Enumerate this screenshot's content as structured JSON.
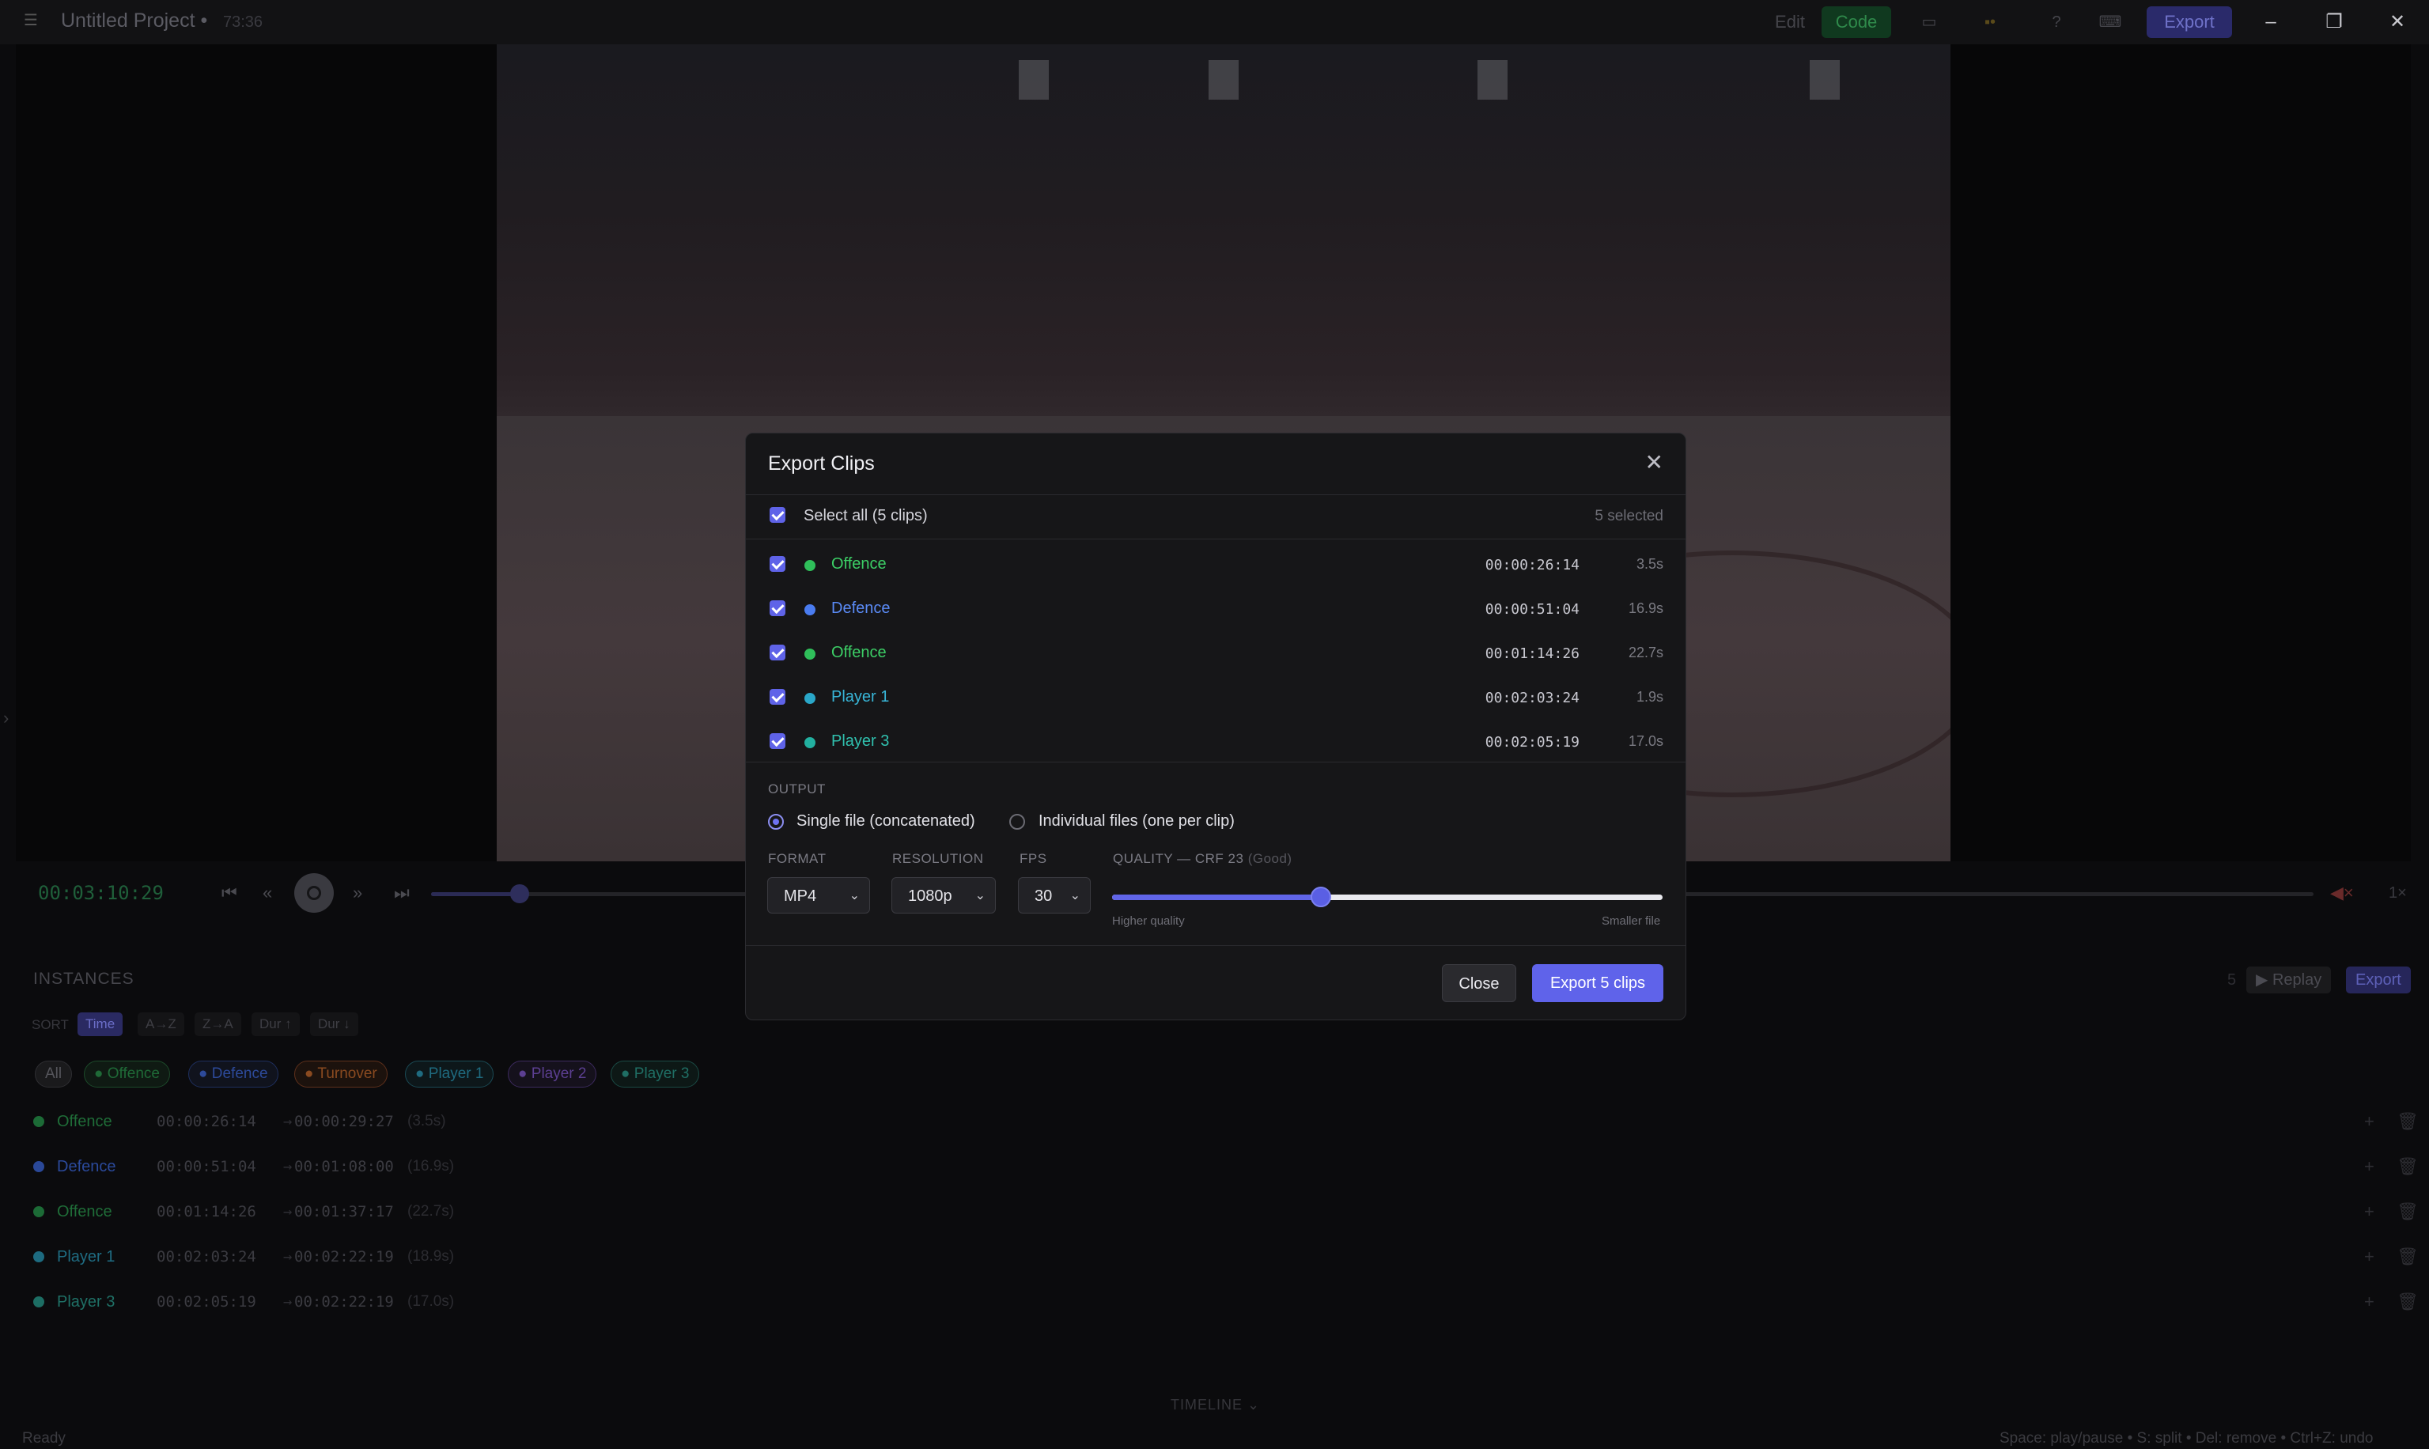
{
  "titlebar": {
    "project_title": "Untitled Project •",
    "project_time": "73:36",
    "edit_label": "Edit",
    "code_label": "Code",
    "export_label": "Export"
  },
  "transport": {
    "timecode": "00:03:10:29",
    "speed": "1×",
    "progress": 0.047
  },
  "instances": {
    "title": "INSTANCES",
    "sort_label": "SORT",
    "sort_options": [
      "Time",
      "A→Z",
      "Z→A",
      "Dur ↑",
      "Dur ↓"
    ],
    "filters": [
      "All",
      "Offence",
      "Defence",
      "Turnover",
      "Player 1",
      "Player 2",
      "Player 3"
    ],
    "count": "5",
    "replay_label": "▶ Replay",
    "export_label": "Export",
    "rows": [
      {
        "name": "Offence",
        "start": "00:00:26:14",
        "end": "00:00:29:27",
        "dur": "(3.5s)"
      },
      {
        "name": "Defence",
        "start": "00:00:51:04",
        "end": "00:01:08:00",
        "dur": "(16.9s)"
      },
      {
        "name": "Offence",
        "start": "00:01:14:26",
        "end": "00:01:37:17",
        "dur": "(22.7s)"
      },
      {
        "name": "Player 1",
        "start": "00:02:03:24",
        "end": "00:02:22:19",
        "dur": "(18.9s)"
      },
      {
        "name": "Player 3",
        "start": "00:02:05:19",
        "end": "00:02:22:19",
        "dur": "(17.0s)"
      }
    ],
    "arrow": "→"
  },
  "footer": {
    "timeline_label": "TIMELINE ⌄",
    "status": "Ready",
    "hint": "Space: play/pause • S: split • Del: remove • Ctrl+Z: undo"
  },
  "modal": {
    "title": "Export Clips",
    "select_all": "Select all (5 clips)",
    "selected_count": "5 selected",
    "clips": [
      {
        "name": "Offence",
        "tc": "00:00:26:14",
        "dur": "3.5s"
      },
      {
        "name": "Defence",
        "tc": "00:00:51:04",
        "dur": "16.9s"
      },
      {
        "name": "Offence",
        "tc": "00:01:14:26",
        "dur": "22.7s"
      },
      {
        "name": "Player 1",
        "tc": "00:02:03:24",
        "dur": "1.9s"
      },
      {
        "name": "Player 3",
        "tc": "00:02:05:19",
        "dur": "17.0s"
      }
    ],
    "output_label": "OUTPUT",
    "output_single": "Single file (concatenated)",
    "output_individual": "Individual files (one per clip)",
    "format_label": "FORMAT",
    "format_value": "MP4",
    "resolution_label": "RESOLUTION",
    "resolution_value": "1080p",
    "fps_label": "FPS",
    "fps_value": "30",
    "quality_label": "QUALITY — CRF 23",
    "quality_note": "(Good)",
    "quality_level": 0.38,
    "higher_quality": "Higher quality",
    "smaller_file": "Smaller file",
    "close_label": "Close",
    "export_label": "Export 5 clips"
  },
  "colors": {
    "offence": "#2fbf5a",
    "defence": "#4a7cf0",
    "player1": "#2aa7c9",
    "player3": "#22b0a0",
    "accent": "#5f63ea"
  }
}
